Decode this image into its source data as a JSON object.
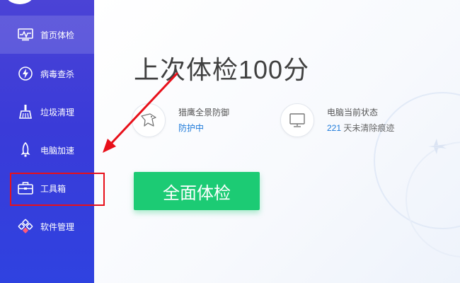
{
  "sidebar": {
    "items": [
      {
        "label": "首页体检",
        "icon": "monitor-pulse-icon",
        "active": true
      },
      {
        "label": "病毒查杀",
        "icon": "lightning-shield-icon",
        "active": false
      },
      {
        "label": "垃圾清理",
        "icon": "broom-icon",
        "active": false
      },
      {
        "label": "电脑加速",
        "icon": "rocket-icon",
        "active": false
      },
      {
        "label": "工具箱",
        "icon": "toolbox-icon",
        "active": false
      },
      {
        "label": "软件管理",
        "icon": "software-puzzle-icon",
        "active": false
      }
    ]
  },
  "main": {
    "title": "上次体检100分",
    "protection": {
      "name": "猎鹰全景防御",
      "status": "防护中",
      "icon": "eagle-icon"
    },
    "pc_status": {
      "name": "电脑当前状态",
      "count": "221",
      "detail": " 天未清除痕迹",
      "icon": "monitor-icon"
    },
    "scan_button": "全面体检"
  },
  "annotation": {
    "color": "#e8101a",
    "target": "工具箱"
  },
  "colors": {
    "sidebar": "#3a3bd8",
    "accent_green": "#1ccb74",
    "link_blue": "#1d7ad9",
    "annotation_red": "#e8101a"
  }
}
